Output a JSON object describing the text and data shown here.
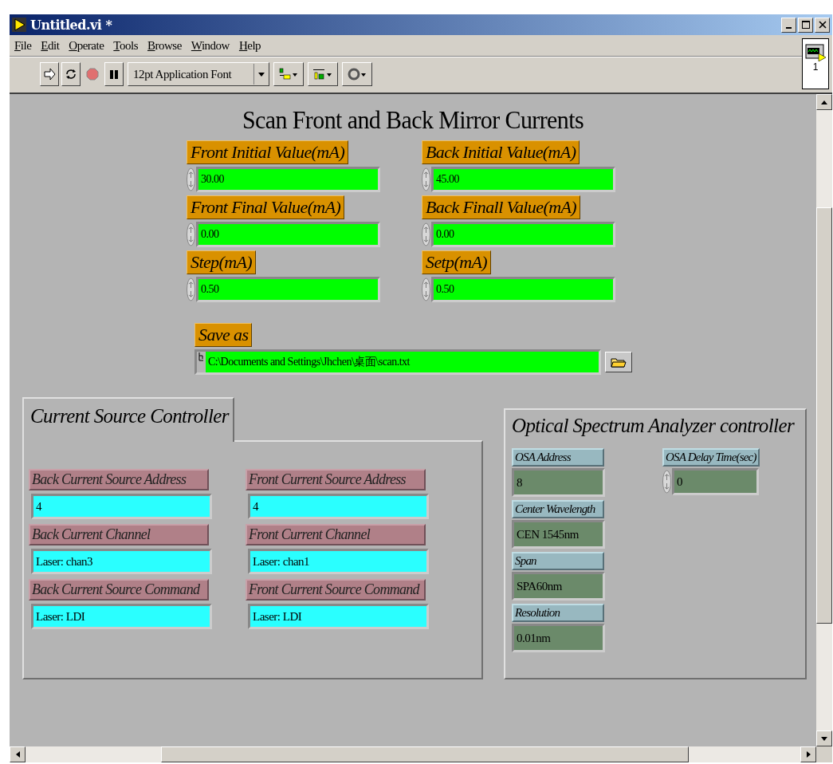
{
  "window": {
    "title": "Untitled.vi *"
  },
  "menu": [
    "File",
    "Edit",
    "Operate",
    "Tools",
    "Browse",
    "Window",
    "Help"
  ],
  "toolbar": {
    "font": "12pt Application Font"
  },
  "icon_pane": {
    "label": "1"
  },
  "panel": {
    "title": "Scan Front and Back Mirror Currents",
    "controls": [
      {
        "label": "Front Initial Value(mA)",
        "value": "30.00",
        "kind": "numeric"
      },
      {
        "label": "Back Initial Value(mA)",
        "value": "45.00",
        "kind": "numeric"
      },
      {
        "label": "Front Final Value(mA)",
        "value": "0.00",
        "kind": "numeric"
      },
      {
        "label": "Back Finall Value(mA)",
        "value": "0.00",
        "kind": "numeric"
      },
      {
        "label": "Step(mA)",
        "value": "0.50",
        "kind": "numeric"
      },
      {
        "label": "Setp(mA)",
        "value": "0.50",
        "kind": "numeric"
      }
    ],
    "save_as": {
      "label": "Save as",
      "value": "C:\\Documents and Settings\\Jhchen\\桌面\\scan.txt"
    }
  },
  "current_source": {
    "title": "Current Source Controller",
    "controls": [
      {
        "label": "Back Current Source Address",
        "value": "4"
      },
      {
        "label": "Front Current Source Address",
        "value": "4"
      },
      {
        "label": "Back Current  Channel",
        "value": "Laser: chan3"
      },
      {
        "label": "Front Current Channel",
        "value": "Laser: chan1"
      },
      {
        "label": "Back Current Source Command",
        "value": "Laser: LDI"
      },
      {
        "label": "Front Current Source Command",
        "value": "Laser: LDI"
      }
    ]
  },
  "osa": {
    "title": "Optical Spectrum Analyzer controller",
    "controls": [
      {
        "label": "OSA Address",
        "value": "8"
      },
      {
        "label": "Center Wavelength",
        "value": "CEN 1545nm"
      },
      {
        "label": "Span",
        "value": "SPA60nm"
      },
      {
        "label": "Resolution",
        "value": "0.01nm"
      }
    ],
    "delay": {
      "label": "OSA Delay Time(sec)",
      "value": "0",
      "kind": "numeric"
    }
  }
}
